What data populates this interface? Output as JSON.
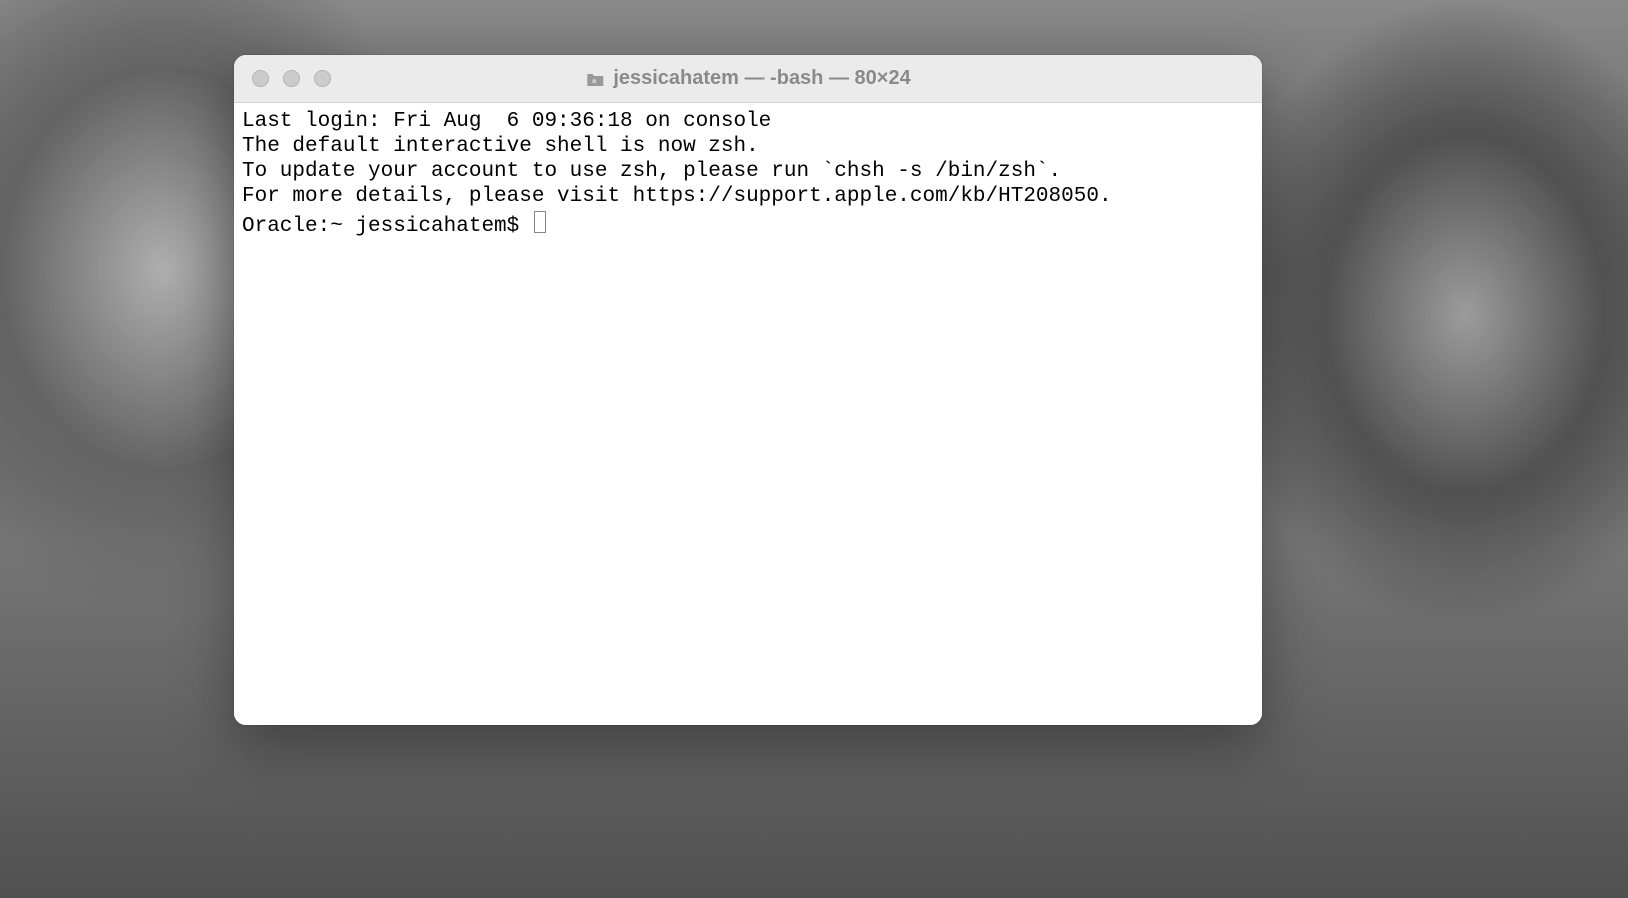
{
  "window": {
    "title": "jessicahatem — -bash — 80×24"
  },
  "terminal": {
    "lines": {
      "last_login": "Last login: Fri Aug  6 09:36:18 on console",
      "blank": "",
      "zsh_notice_1": "The default interactive shell is now zsh.",
      "zsh_notice_2": "To update your account to use zsh, please run `chsh -s /bin/zsh`.",
      "zsh_notice_3": "For more details, please visit https://support.apple.com/kb/HT208050."
    },
    "prompt": "Oracle:~ jessicahatem$ "
  }
}
